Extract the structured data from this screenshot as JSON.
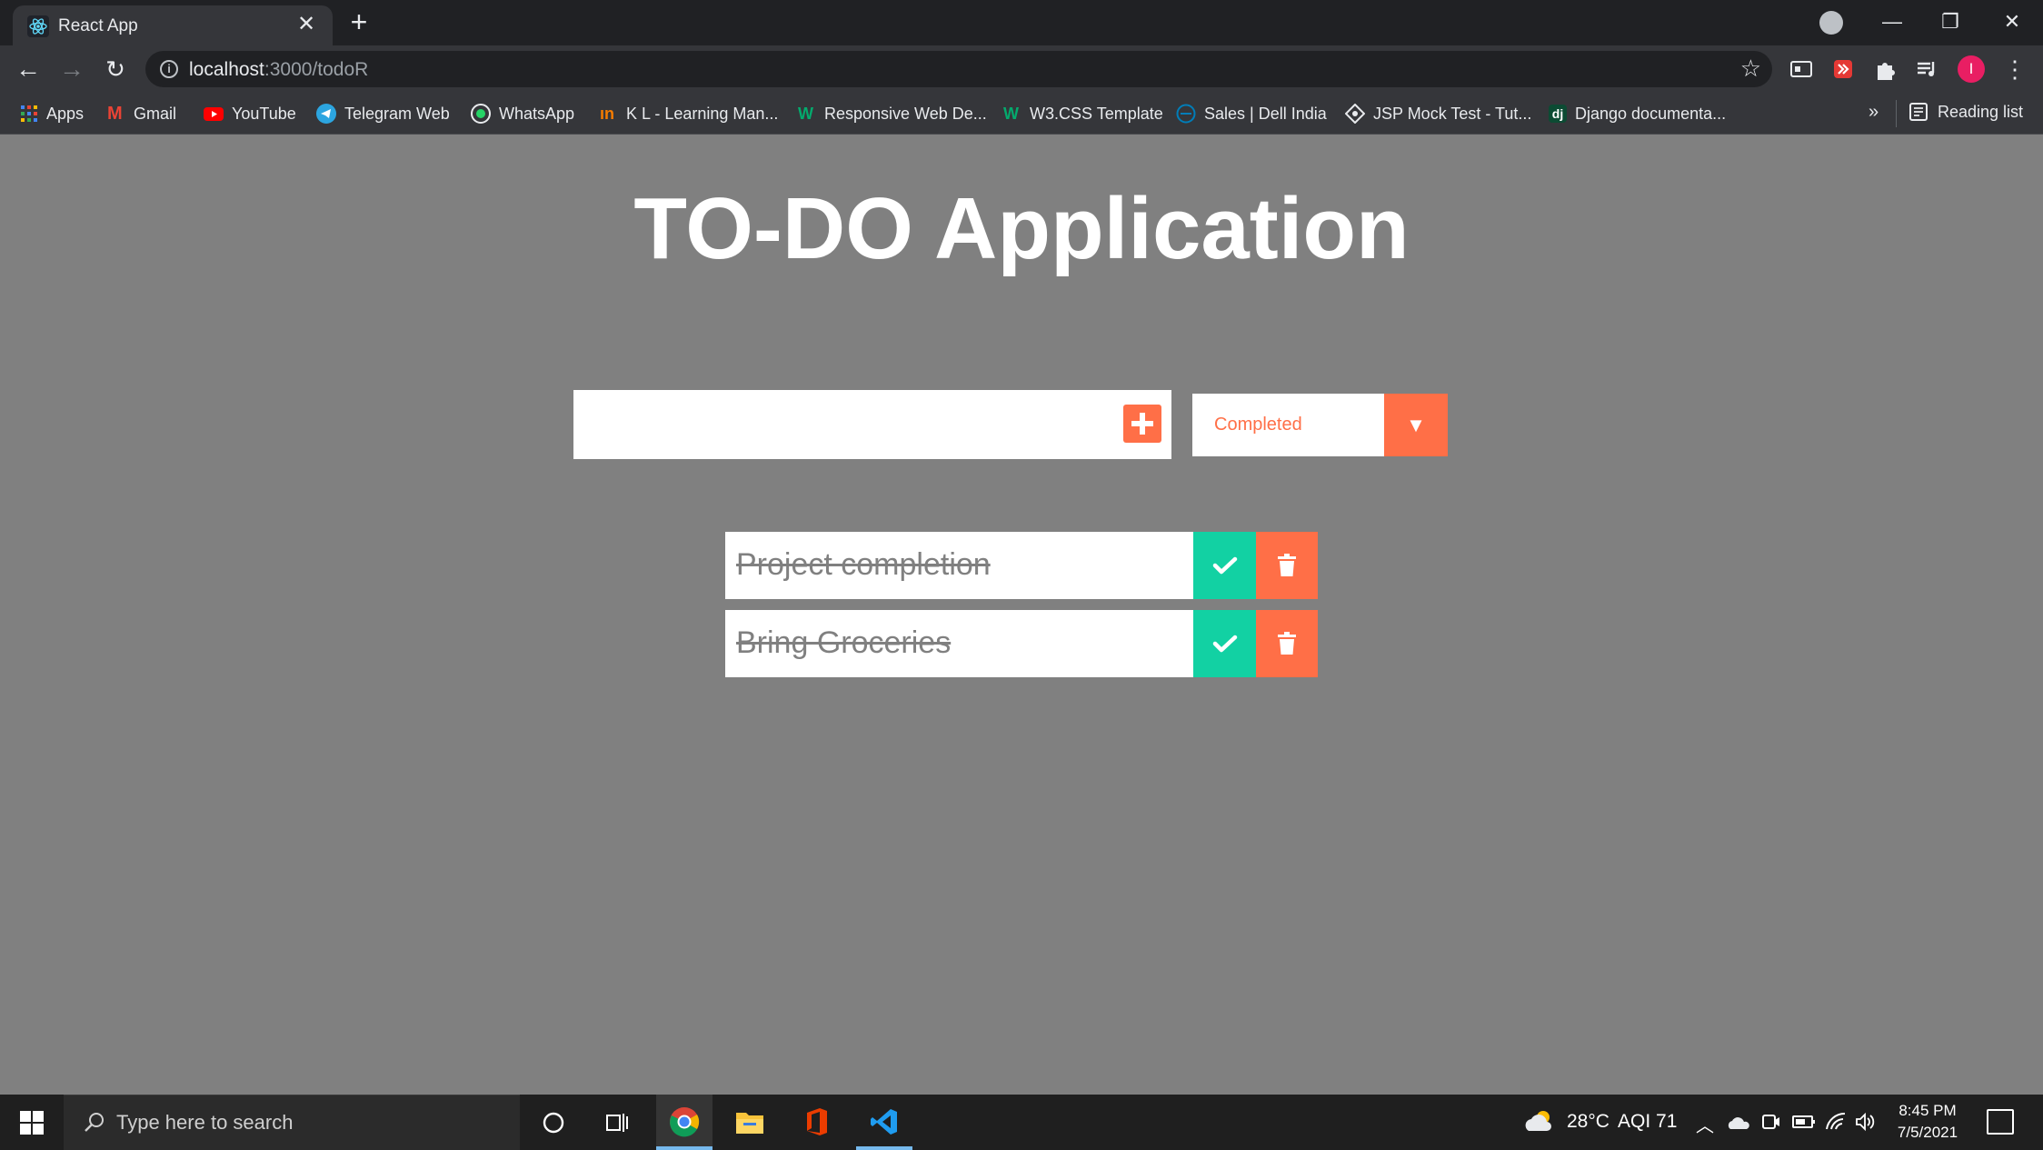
{
  "browser": {
    "tab_title": "React App",
    "url_host": "localhost",
    "url_path": ":3000/todoR",
    "bookmarks": [
      {
        "label": "Apps",
        "color": "#4285f4"
      },
      {
        "label": "Gmail",
        "color": "#ea4335"
      },
      {
        "label": "YouTube",
        "color": "#ff0000"
      },
      {
        "label": "Telegram Web",
        "color": "#2ca5e0"
      },
      {
        "label": "WhatsApp",
        "color": "#25d366"
      },
      {
        "label": "K L - Learning Man...",
        "color": "#f57c00"
      },
      {
        "label": "Responsive Web De...",
        "color": "#04aa6d"
      },
      {
        "label": "W3.CSS Template",
        "color": "#04aa6d"
      },
      {
        "label": "Sales | Dell India",
        "color": "#007db8"
      },
      {
        "label": "JSP Mock Test - Tut...",
        "color": "#9e9e9e"
      },
      {
        "label": "Django documenta...",
        "color": "#0c4b33"
      }
    ],
    "more_bookmarks": "»",
    "reading_list": "Reading list",
    "profile_initial": "I"
  },
  "app": {
    "title": "TO-DO Application",
    "input_value": "",
    "filter_selected": "Completed",
    "todos": [
      {
        "text": "Project completion",
        "completed": true
      },
      {
        "text": "Bring Groceries",
        "completed": true
      }
    ],
    "colors": {
      "accent": "#ff6f47",
      "complete": "#12d1a3",
      "background": "#808080"
    }
  },
  "taskbar": {
    "search_placeholder": "Type here to search",
    "weather": "28°C",
    "aqi": "AQI 71",
    "time": "8:45 PM",
    "date": "7/5/2021"
  }
}
